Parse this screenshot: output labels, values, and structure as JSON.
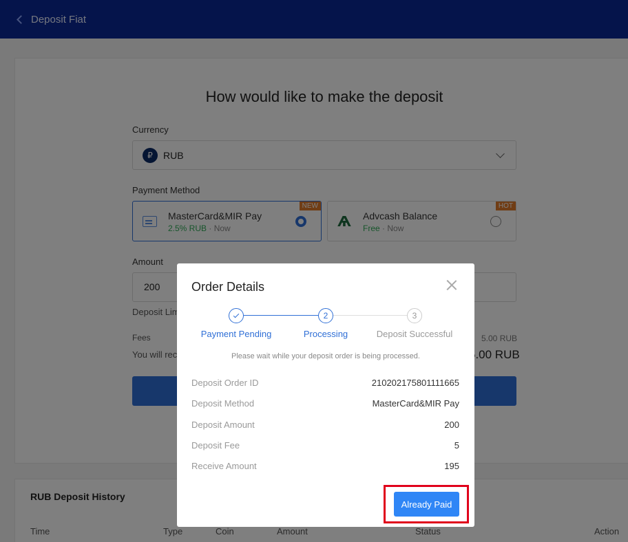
{
  "header": {
    "title": "Deposit Fiat"
  },
  "form": {
    "heading": "How would like to make the deposit",
    "currency_label": "Currency",
    "currency_symbol": "₽",
    "currency_value": "RUB",
    "payment_label": "Payment Method",
    "methods": [
      {
        "name": "MasterCard&MIR Pay",
        "fee": "2.5% RUB",
        "speed": "· Now",
        "tag": "NEW",
        "selected": true
      },
      {
        "name": "Advcash Balance",
        "fee": "Free",
        "speed": "· Now",
        "tag": "HOT",
        "selected": false
      }
    ],
    "amount_label": "Amount",
    "amount_value": "200",
    "limit_label": "Deposit Lim",
    "fees_label": "Fees",
    "fees_value": "5.00 RUB",
    "receive_label": "You will rec",
    "receive_value": "5.00 RUB"
  },
  "history": {
    "title": "RUB Deposit History",
    "columns": [
      "Time",
      "Type",
      "Coin",
      "Amount",
      "Status",
      "Action"
    ]
  },
  "modal": {
    "title": "Order Details",
    "steps": [
      {
        "num": "1",
        "label": "Payment Pending"
      },
      {
        "num": "2",
        "label": "Processing"
      },
      {
        "num": "3",
        "label": "Deposit Successful"
      }
    ],
    "note": "Please wait while your deposit order is being processed.",
    "rows": [
      {
        "key": "Deposit Order ID",
        "value": "210202175801111665"
      },
      {
        "key": "Deposit Method",
        "value": "MasterCard&MIR Pay"
      },
      {
        "key": "Deposit Amount",
        "value": "200"
      },
      {
        "key": "Deposit Fee",
        "value": "5"
      },
      {
        "key": "Receive Amount",
        "value": "195"
      }
    ],
    "paid_button": "Already Paid"
  },
  "colors": {
    "header": "#0a2996",
    "primary": "#2f6fd6",
    "button": "#2f86f6",
    "highlight": "#e0001b",
    "green": "#2eaa57"
  }
}
